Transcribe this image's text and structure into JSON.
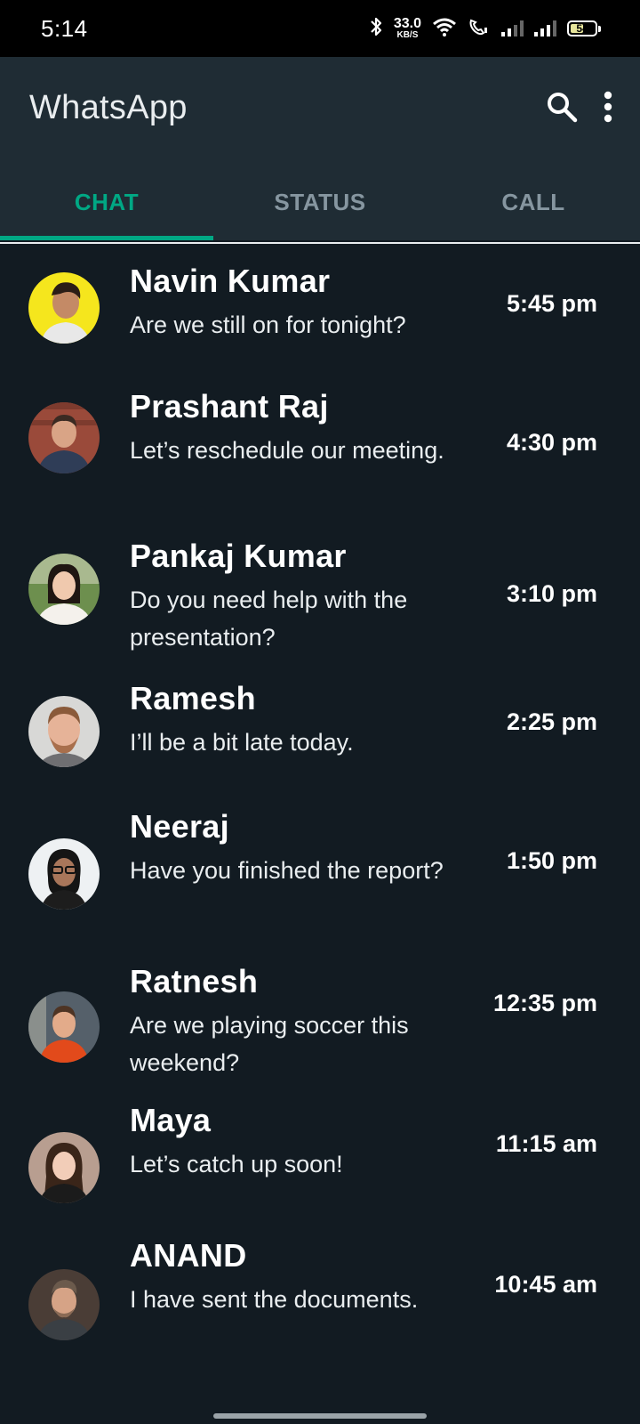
{
  "status_bar": {
    "time": "5:14",
    "net_speed_value": "33.0",
    "net_speed_unit": "KB/S",
    "battery": "54"
  },
  "header": {
    "title": "WhatsApp",
    "icons": [
      "search-icon",
      "more-vert-icon"
    ]
  },
  "tabs": [
    {
      "label": "CHAT",
      "active": true
    },
    {
      "label": "STATUS",
      "active": false
    },
    {
      "label": "CALL",
      "active": false
    }
  ],
  "colors": {
    "accent": "#00a884",
    "header_bg": "#1f2c34",
    "list_bg": "#121b22"
  },
  "chats": [
    {
      "name": "Navin Kumar",
      "message": "Are we still on for tonight?",
      "time": "5:45 pm"
    },
    {
      "name": "Prashant Raj",
      "message": "Let’s reschedule our meeting.",
      "time": "4:30 pm"
    },
    {
      "name": "Pankaj Kumar",
      "message": "Do you need help with the presentation?",
      "time": "3:10 pm"
    },
    {
      "name": "Ramesh",
      "message": "I’ll be a bit late today.",
      "time": "2:25 pm"
    },
    {
      "name": "Neeraj",
      "message": "Have you finished the report?",
      "time": "1:50 pm"
    },
    {
      "name": "Ratnesh",
      "message": "Are we playing soccer this weekend?",
      "time": "12:35 pm"
    },
    {
      "name": "Maya",
      "message": "Let’s catch up soon!",
      "time": "11:15 am"
    },
    {
      "name": "ANAND",
      "message": "I have sent the documents.",
      "time": "10:45 am"
    }
  ]
}
